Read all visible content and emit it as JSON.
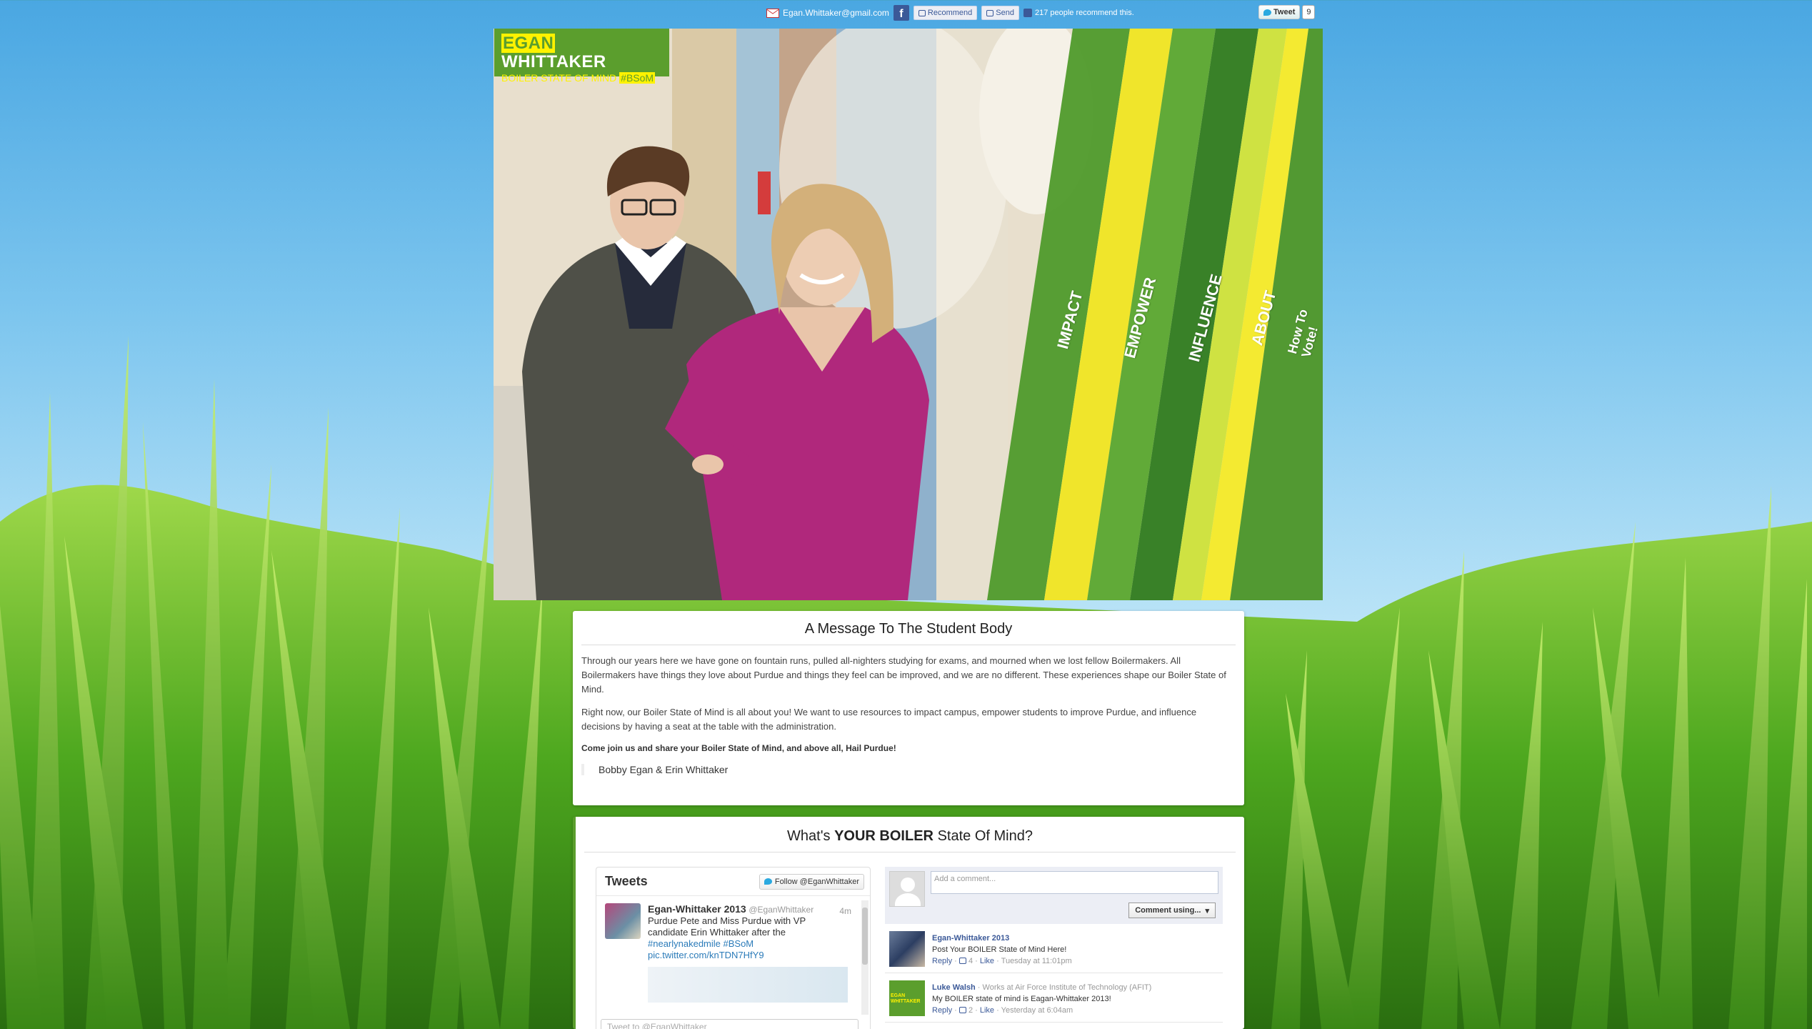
{
  "colors": {
    "brand_green": "#5b9e2d",
    "brand_yellow": "#fff200",
    "facebook_blue": "#3b5998",
    "twitter_blue": "#2aa9e0"
  },
  "topbar": {
    "email": "Egan.Whittaker@gmail.com",
    "recommend_label": "Recommend",
    "send_label": "Send",
    "recommend_count_text": "217 people recommend this.",
    "tweet_label": "Tweet",
    "tweet_count": "9"
  },
  "logo": {
    "word1": "EGAN",
    "word2": "WHITTAKER",
    "tagline": "BOILER STATE OF MIND",
    "hashtag": "#BSoM"
  },
  "nav": [
    {
      "label": "IMPACT"
    },
    {
      "label": "EMPOWER"
    },
    {
      "label": "INFLUENCE"
    },
    {
      "label": "ABOUT"
    },
    {
      "label": "How To Vote!"
    }
  ],
  "message": {
    "title": "A Message To The Student Body",
    "para1": "Through our years here we have gone on fountain runs, pulled all-nighters studying for exams, and mourned when we lost fellow Boilermakers. All Boilermakers have things they love about Purdue and things they feel can be improved, and we are no different. These experiences shape our Boiler State of Mind.",
    "para2": "Right now, our Boiler State of Mind is all about you! We want to use resources to impact campus, empower students to improve Purdue, and influence decisions by having a seat at the table with the administration.",
    "para3": "Come join us and share your Boiler State of Mind, and above all, Hail Purdue!",
    "signature": "Bobby Egan & Erin Whittaker"
  },
  "boiler": {
    "title_pre": "What's",
    "title_bold": "YOUR BOILER",
    "title_post": "State Of Mind?"
  },
  "twitter": {
    "header": "Tweets",
    "follow_label": "Follow @EganWhittaker",
    "tweet": {
      "name": "Egan-Whittaker 2013",
      "handle": "@EganWhittaker",
      "time": "4m",
      "text": "Purdue Pete and Miss Purdue with VP candidate Erin Whittaker after the",
      "hashtags": "#nearlynakedmile #BSoM",
      "link": "pic.twitter.com/knTDN7HfY9"
    },
    "compose_placeholder": "Tweet to @EganWhittaker"
  },
  "facebook_comments": {
    "placeholder": "Add a comment...",
    "comment_button": "Comment using...",
    "comments": [
      {
        "author": "Egan-Whittaker 2013",
        "author_meta": "",
        "text": "Post Your BOILER State of Mind Here!",
        "reply": "Reply",
        "likes": "4",
        "like": "Like",
        "time": "Tuesday at 11:01pm"
      },
      {
        "author": "Luke Walsh",
        "author_meta": "Works at Air Force Institute of Technology (AFIT)",
        "text": "My BOILER state of mind is Eagan-Whittaker 2013!",
        "reply": "Reply",
        "likes": "2",
        "like": "Like",
        "time": "Yesterday at 6:04am"
      }
    ]
  }
}
